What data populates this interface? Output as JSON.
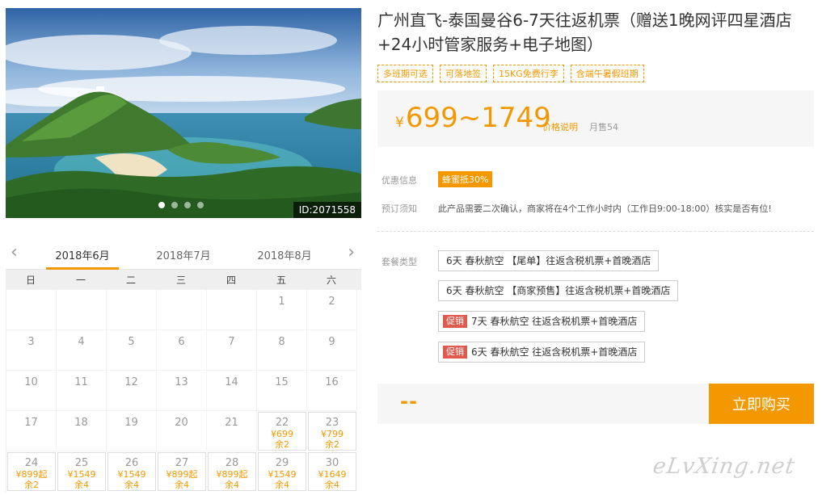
{
  "product": {
    "title": "广州直飞-泰国曼谷6-7天往返机票（赠送1晚网评四星酒店+24小时管家服务+电子地图）",
    "tags": [
      "多班期可选",
      "可落地签",
      "15KG免费行李",
      "含端午暑假班期"
    ],
    "price_symbol": "¥",
    "price_range": "699~1749",
    "price_note": "价格说明",
    "sold": "月售54"
  },
  "photo": {
    "id_label": "ID:2071558",
    "slides": 4,
    "active_slide": 1
  },
  "info": {
    "promo_label": "优惠信息",
    "promo_badge": "蜂蜜抵30%",
    "notice_label": "预订须知",
    "notice_text": "此产品需要二次确认，商家将在4个工作小时内（工作日9:00-18:00）核实是否有位!"
  },
  "packages": {
    "label": "套餐类型",
    "items": [
      {
        "sale": "",
        "text": "6天 春秋航空 【尾单】往返含税机票+首晚酒店"
      },
      {
        "sale": "",
        "text": "6天 春秋航空 【商家预售】往返含税机票+首晚酒店"
      },
      {
        "sale": "促销",
        "text": "7天 春秋航空 往返含税机票+首晚酒店"
      },
      {
        "sale": "促销",
        "text": "6天 春秋航空 往返含税机票+首晚酒店"
      }
    ]
  },
  "buy": {
    "total": "--",
    "button": "立即购买"
  },
  "calendar": {
    "prev": "‹",
    "next": "›",
    "months": [
      "2018年6月",
      "2018年7月",
      "2018年8月"
    ],
    "active_month": 0,
    "weekdays": [
      "日",
      "一",
      "二",
      "三",
      "四",
      "五",
      "六"
    ],
    "leading_blanks": 5,
    "days": [
      {
        "d": "1"
      },
      {
        "d": "2"
      },
      {
        "d": "3"
      },
      {
        "d": "4"
      },
      {
        "d": "5"
      },
      {
        "d": "6"
      },
      {
        "d": "7"
      },
      {
        "d": "8"
      },
      {
        "d": "9"
      },
      {
        "d": "10"
      },
      {
        "d": "11"
      },
      {
        "d": "12"
      },
      {
        "d": "13"
      },
      {
        "d": "14"
      },
      {
        "d": "15"
      },
      {
        "d": "16"
      },
      {
        "d": "17"
      },
      {
        "d": "18"
      },
      {
        "d": "19"
      },
      {
        "d": "20"
      },
      {
        "d": "21"
      },
      {
        "d": "22",
        "p": "¥699",
        "r": "余2"
      },
      {
        "d": "23",
        "p": "¥799",
        "r": "余2"
      },
      {
        "d": "24",
        "p": "¥899起",
        "r": "余2"
      },
      {
        "d": "25",
        "p": "¥1549",
        "r": "余4"
      },
      {
        "d": "26",
        "p": "¥1549",
        "r": "余4"
      },
      {
        "d": "27",
        "p": "¥899起",
        "r": "余4"
      },
      {
        "d": "28",
        "p": "¥899起",
        "r": "余4"
      },
      {
        "d": "29",
        "p": "¥1549",
        "r": "余4"
      },
      {
        "d": "30",
        "p": "¥1649",
        "r": "余4"
      }
    ]
  },
  "watermark": "eLvXing.net",
  "colors": {
    "accent": "#f39800",
    "sale": "#e05a4e"
  }
}
